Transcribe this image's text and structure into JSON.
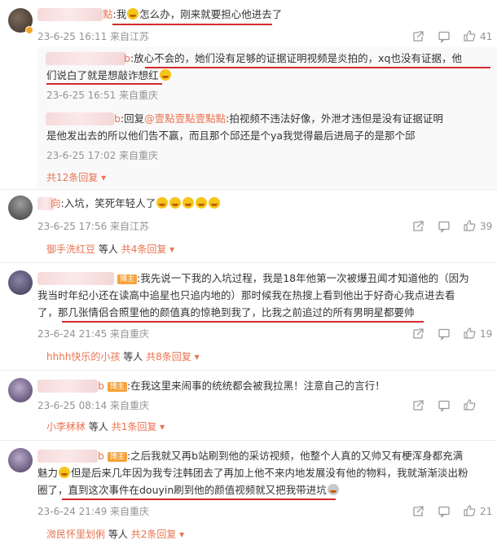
{
  "comments": [
    {
      "name_suffix": "點",
      "lines": [
        ":我",
        "怎么办，刚来就要担心他进去了"
      ],
      "meta": "23-6-25 16:11 来自江苏",
      "likes": "41"
    },
    {
      "name_suffix": "b",
      "lines": [
        ":放心不会的，她们没有足够的证据证明视频是炎拍的，xq也没有证据，他",
        "们说白了就是想敲诈想红"
      ],
      "meta": "23-6-25 16:51 来自重庆"
    },
    {
      "name_suffix": "b",
      "line1_prefix": ":回复",
      "line1_mention": "@壹點壹點壹點點",
      "line1_rest": ":拍视频不违法好像，外泄才违但是没有证据证明",
      "line2": "是他发出去的所以他们告不赢，而且那个邱还是个ya我觉得最后进局子的是那个邱",
      "meta": "23-6-25 17:02 来自重庆",
      "more": "共12条回复"
    },
    {
      "name_suffix": "向",
      "text": ":入坑，笑死年轻人了",
      "meta": "23-6-25 17:56 来自江苏",
      "likes": "39",
      "replier": "御手洗红豆",
      "others": "等人",
      "more": "共4条回复"
    },
    {
      "badge": "博主",
      "lines": [
        ":我先说一下我的入坑过程，我是18年他第一次被爆丑闻才知道他的（因为",
        "我当时年纪小还在读高中追星也只追内地的）那时候我在热搜上看到他出于好奇心我点进去看",
        "了，那几张情侣合照里他的颜值真的惊艳到我了，比我之前追过的所有男明星都要帅"
      ],
      "meta": "23-6-24 21:45 来自重庆",
      "likes": "19",
      "replier": "hhhh快乐的小孩",
      "others": "等人",
      "more": "共8条回复"
    },
    {
      "name_suffix": "b",
      "badge": "博主",
      "text": ":在我这里来闹事的统统都会被我拉黑！注意自己的言行！",
      "meta": "23-6-25 08:14 来自重庆",
      "replier": "小李秫秫",
      "others": "等人",
      "more": "共1条回复"
    },
    {
      "name_suffix": "b",
      "badge": "博主",
      "lines": [
        ":之后我就又再b站刷到他的采访视频，他整个人真的又帅又有梗浑身都充满",
        "魅力",
        "但是后来几年因为我专注韩团去了再加上他不来内地发展没有他的物料，我就渐渐淡出粉",
        "圈了，直到这次事件在douyin刷到他的颜值视频就又把我带进坑"
      ],
      "meta": "23-6-24 21:49 来自重庆",
      "likes": "21",
      "replier": "溦民怀里划俐",
      "others": "等人",
      "more": "共2条回复"
    }
  ],
  "colors": {
    "accent": "#eb7350",
    "underline": "#d22b2b",
    "meta": "#939393"
  },
  "icons": [
    "share-icon",
    "comment-icon",
    "like-icon"
  ]
}
